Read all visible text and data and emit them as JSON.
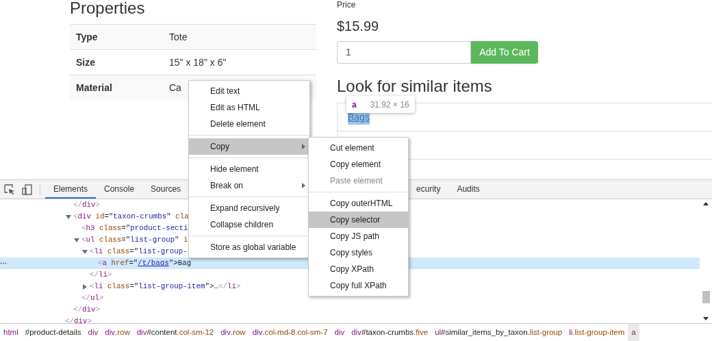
{
  "page": {
    "properties": {
      "title": "Properties",
      "rows": [
        {
          "label": "Type",
          "value": "Tote"
        },
        {
          "label": "Size",
          "value": "15\" x 18\" x 6\""
        },
        {
          "label": "Material",
          "value": "Ca"
        }
      ]
    },
    "product": {
      "price_label": "Price",
      "price": "$15.99",
      "quantity": {
        "value": "1"
      },
      "add_button": "Add To Cart",
      "similar": {
        "title": "Look for similar items",
        "items": [
          {
            "label": "Bags",
            "highlighted": true
          }
        ]
      }
    },
    "tooltip": {
      "tag": "a",
      "size": "31.92 × 16"
    }
  },
  "devtools": {
    "tabs": [
      {
        "label": "Elements",
        "selected": true
      },
      {
        "label": "Console",
        "selected": false
      },
      {
        "label": "Sources",
        "selected": false
      },
      {
        "label": "ecurity",
        "selected": false
      },
      {
        "label": "Audits",
        "selected": false
      }
    ],
    "dom": {
      "closing": [
        {
          "text": "</",
          "kind": "punct"
        },
        {
          "text": "div",
          "kind": "tag"
        },
        {
          "text": ">",
          "kind": "punct"
        }
      ],
      "children": [
        {
          "tokens": [
            {
              "text": "</",
              "kind": "punct"
            },
            {
              "text": "div",
              "kind": "tag"
            },
            {
              "text": ">",
              "kind": "punct"
            }
          ]
        },
        {
          "tokens": [
            {
              "text": "<",
              "kind": "punct"
            },
            {
              "text": "div",
              "kind": "tag"
            },
            {
              "text": " id",
              "kind": "attr"
            },
            {
              "text": "=\"",
              "kind": "plain"
            },
            {
              "text": "taxon-crumbs",
              "kind": "value"
            },
            {
              "text": "\"",
              "kind": "plain"
            },
            {
              "text": " cla",
              "kind": "attr"
            }
          ],
          "expanded": true,
          "selected": false,
          "closing": [
            {
              "text": "</",
              "kind": "punct"
            },
            {
              "text": "div",
              "kind": "tag"
            },
            {
              "text": ">",
              "kind": "punct"
            }
          ],
          "children": [
            {
              "tokens": [
                {
                  "text": "<",
                  "kind": "punct"
                },
                {
                  "text": "h3",
                  "kind": "tag"
                },
                {
                  "text": " class",
                  "kind": "attr"
                },
                {
                  "text": "=\"",
                  "kind": "plain"
                },
                {
                  "text": "product-secti",
                  "kind": "value"
                }
              ]
            },
            {
              "tokens": [
                {
                  "text": "<",
                  "kind": "punct"
                },
                {
                  "text": "ul",
                  "kind": "tag"
                },
                {
                  "text": " class",
                  "kind": "attr"
                },
                {
                  "text": "=\"",
                  "kind": "plain"
                },
                {
                  "text": "list-group",
                  "kind": "value"
                },
                {
                  "text": "\"",
                  "kind": "plain"
                },
                {
                  "text": " i",
                  "kind": "attr"
                }
              ],
              "expanded": true,
              "selected": false,
              "closing": [
                {
                  "text": "</",
                  "kind": "punct"
                },
                {
                  "text": "ul",
                  "kind": "tag"
                },
                {
                  "text": ">",
                  "kind": "punct"
                }
              ],
              "children": [
                {
                  "tokens": [
                    {
                      "text": "<",
                      "kind": "punct"
                    },
                    {
                      "text": "li",
                      "kind": "tag"
                    },
                    {
                      "text": " class",
                      "kind": "attr"
                    },
                    {
                      "text": "=\"",
                      "kind": "plain"
                    },
                    {
                      "text": "list-group-",
                      "kind": "value"
                    }
                  ],
                  "expanded": true,
                  "selected": false,
                  "closing": [
                    {
                      "text": "</",
                      "kind": "punct"
                    },
                    {
                      "text": "li",
                      "kind": "tag"
                    },
                    {
                      "text": ">",
                      "kind": "punct"
                    }
                  ],
                  "children": [
                    {
                      "tokens": [
                        {
                          "text": "<",
                          "kind": "punct"
                        },
                        {
                          "text": "a",
                          "kind": "tag"
                        },
                        {
                          "text": " href",
                          "kind": "attr"
                        },
                        {
                          "text": "=\"",
                          "kind": "plain"
                        },
                        {
                          "text": "/t/bags",
                          "kind": "link"
                        },
                        {
                          "text": "\">",
                          "kind": "plain"
                        },
                        {
                          "text": "Bag",
                          "kind": "plain"
                        }
                      ],
                      "selected": true
                    }
                  ]
                },
                {
                  "tokens": [
                    {
                      "text": "<",
                      "kind": "punct"
                    },
                    {
                      "text": "li",
                      "kind": "tag"
                    },
                    {
                      "text": " class",
                      "kind": "attr"
                    },
                    {
                      "text": "=\"",
                      "kind": "plain"
                    },
                    {
                      "text": "list-group-item",
                      "kind": "value"
                    },
                    {
                      "text": "\">",
                      "kind": "plain"
                    },
                    {
                      "text": "…",
                      "kind": "plain"
                    },
                    {
                      "text": "</",
                      "kind": "punct"
                    },
                    {
                      "text": "li",
                      "kind": "tag"
                    },
                    {
                      "text": ">",
                      "kind": "punct"
                    }
                  ],
                  "expanded": false,
                  "selected": false
                }
              ]
            }
          ]
        }
      ]
    },
    "breadcrumbs": [
      {
        "parts": [
          {
            "text": "html",
            "kind": "tag"
          }
        ],
        "selected": false
      },
      {
        "parts": [
          {
            "text": "#product-details",
            "kind": "id"
          }
        ],
        "selected": false
      },
      {
        "parts": [
          {
            "text": "div",
            "kind": "tag"
          }
        ],
        "selected": false
      },
      {
        "parts": [
          {
            "text": "div",
            "kind": "tag"
          },
          {
            "text": ".row",
            "kind": "class"
          }
        ],
        "selected": false
      },
      {
        "parts": [
          {
            "text": "div",
            "kind": "tag"
          },
          {
            "text": "#content",
            "kind": "id"
          },
          {
            "text": ".col-sm-12",
            "kind": "class"
          }
        ],
        "selected": false
      },
      {
        "parts": [
          {
            "text": "div",
            "kind": "tag"
          },
          {
            "text": ".row",
            "kind": "class"
          }
        ],
        "selected": false
      },
      {
        "parts": [
          {
            "text": "div",
            "kind": "tag"
          },
          {
            "text": ".col-md-8.col-sm-7",
            "kind": "class"
          }
        ],
        "selected": false
      },
      {
        "parts": [
          {
            "text": "div",
            "kind": "tag"
          }
        ],
        "selected": false
      },
      {
        "parts": [
          {
            "text": "div",
            "kind": "tag"
          },
          {
            "text": "#taxon-crumbs",
            "kind": "id"
          },
          {
            "text": ".five",
            "kind": "class"
          }
        ],
        "selected": false
      },
      {
        "parts": [
          {
            "text": "ul",
            "kind": "tag"
          },
          {
            "text": "#similar_items_by_taxon",
            "kind": "id"
          },
          {
            "text": ".list-group",
            "kind": "class"
          }
        ],
        "selected": false
      },
      {
        "parts": [
          {
            "text": "li",
            "kind": "tag"
          },
          {
            "text": ".list-group-item",
            "kind": "class"
          }
        ],
        "selected": false
      },
      {
        "parts": [
          {
            "text": "a",
            "kind": "tag"
          }
        ],
        "selected": true
      }
    ]
  },
  "context_menu": {
    "groups": [
      [
        {
          "label": "Edit text",
          "selected": false,
          "submenu": false
        },
        {
          "label": "Edit as HTML",
          "selected": false,
          "submenu": false
        },
        {
          "label": "Delete element",
          "selected": false,
          "submenu": false
        }
      ],
      [
        {
          "label": "Copy",
          "selected": true,
          "submenu": true
        }
      ],
      [
        {
          "label": "Hide element",
          "selected": false,
          "submenu": false
        },
        {
          "label": "Break on",
          "selected": false,
          "submenu": true
        }
      ],
      [
        {
          "label": "Expand recursively",
          "selected": false,
          "submenu": false
        },
        {
          "label": "Collapse children",
          "selected": false,
          "submenu": false
        }
      ],
      [
        {
          "label": "Store as global variable",
          "selected": false,
          "submenu": false
        }
      ]
    ]
  },
  "submenu": {
    "groups": [
      [
        {
          "label": "Cut element",
          "selected": false,
          "disabled": false
        },
        {
          "label": "Copy element",
          "selected": false,
          "disabled": false
        },
        {
          "label": "Paste element",
          "selected": false,
          "disabled": true
        }
      ],
      [
        {
          "label": "Copy outerHTML",
          "selected": false,
          "disabled": false
        },
        {
          "label": "Copy selector",
          "selected": true,
          "disabled": false
        },
        {
          "label": "Copy JS path",
          "selected": false,
          "disabled": false
        },
        {
          "label": "Copy styles",
          "selected": false,
          "disabled": false
        },
        {
          "label": "Copy XPath",
          "selected": false,
          "disabled": false
        },
        {
          "label": "Copy full XPath",
          "selected": false,
          "disabled": false
        }
      ]
    ]
  }
}
